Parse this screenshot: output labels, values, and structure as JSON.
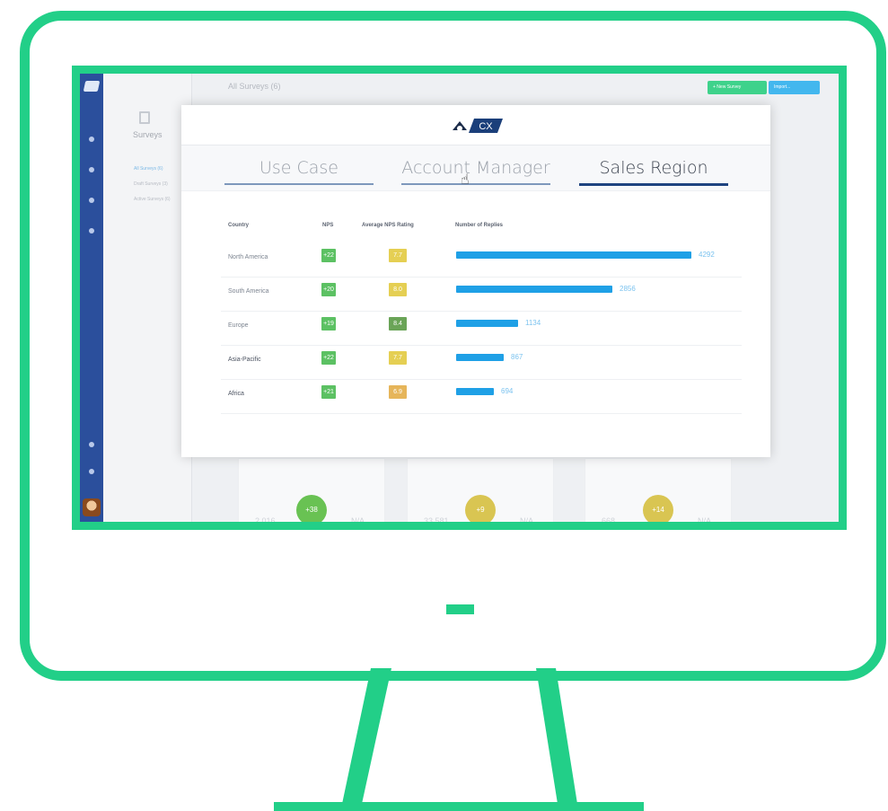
{
  "app": {
    "topbar_title": "All Surveys (6)",
    "buttons": {
      "new_survey": "+ New Survey",
      "import": "Import..."
    },
    "nav": {
      "title": "Surveys",
      "links": [
        "All Surveys (6)",
        "Draft Surveys (3)",
        "Active Surveys (6)"
      ]
    },
    "bg_cards": [
      {
        "count": "2,016",
        "score": "+38",
        "na": "N/A",
        "color": "#69c253"
      },
      {
        "count": "33,581",
        "score": "+9",
        "na": "N/A",
        "color": "#d9c552"
      },
      {
        "count": "668",
        "score": "+14",
        "na": "N/A",
        "color": "#d9c552"
      }
    ]
  },
  "modal": {
    "logo_text": "CX",
    "tabs": [
      "Use Case",
      "Account Manager",
      "Sales Region"
    ],
    "active_tab": "Sales Region",
    "columns": [
      "Country",
      "NPS",
      "Average NPS Rating",
      "Number of Replies"
    ],
    "rows": [
      {
        "country": "North America",
        "nps": "+22",
        "rating": "7.7",
        "replies": 4292
      },
      {
        "country": "South America",
        "nps": "+20",
        "rating": "8.0",
        "replies": 2856
      },
      {
        "country": "Europe",
        "nps": "+19",
        "rating": "8.4",
        "replies": 1134
      },
      {
        "country": "Asia-Pacific",
        "nps": "+22",
        "rating": "7.7",
        "replies": 867
      },
      {
        "country": "Africa",
        "nps": "+21",
        "rating": "6.9",
        "replies": 694
      }
    ],
    "replies_scale_max": 4292
  },
  "colors": {
    "frame": "#22cf88",
    "nps_green": "#5cc163",
    "rating_yellow": "#e5cf53",
    "rating_green": "#6aa457",
    "rating_orange": "#e6b55a",
    "bar_blue": "#1fa0e6"
  }
}
